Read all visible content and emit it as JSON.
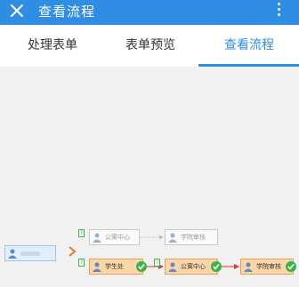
{
  "app": {
    "title": "查看流程"
  },
  "tabs": [
    {
      "label": "处理表单"
    },
    {
      "label": "表单预览"
    },
    {
      "label": "查看流程"
    }
  ],
  "flow": {
    "start_node": {
      "label": ""
    },
    "branch_badges": [
      "?",
      "?"
    ],
    "nodes_top": [
      {
        "label": "公寓中心"
      },
      {
        "label": "学院审核"
      }
    ],
    "nodes_bottom": [
      {
        "label": "学生处"
      },
      {
        "label": "公寓中心"
      },
      {
        "label": "学院审核"
      }
    ],
    "mid_badge": "?"
  },
  "colors": {
    "accent": "#2f8de4",
    "done": "#3cb34a",
    "active_fill": "#fbd6a9",
    "link_red": "#d23b3b"
  }
}
